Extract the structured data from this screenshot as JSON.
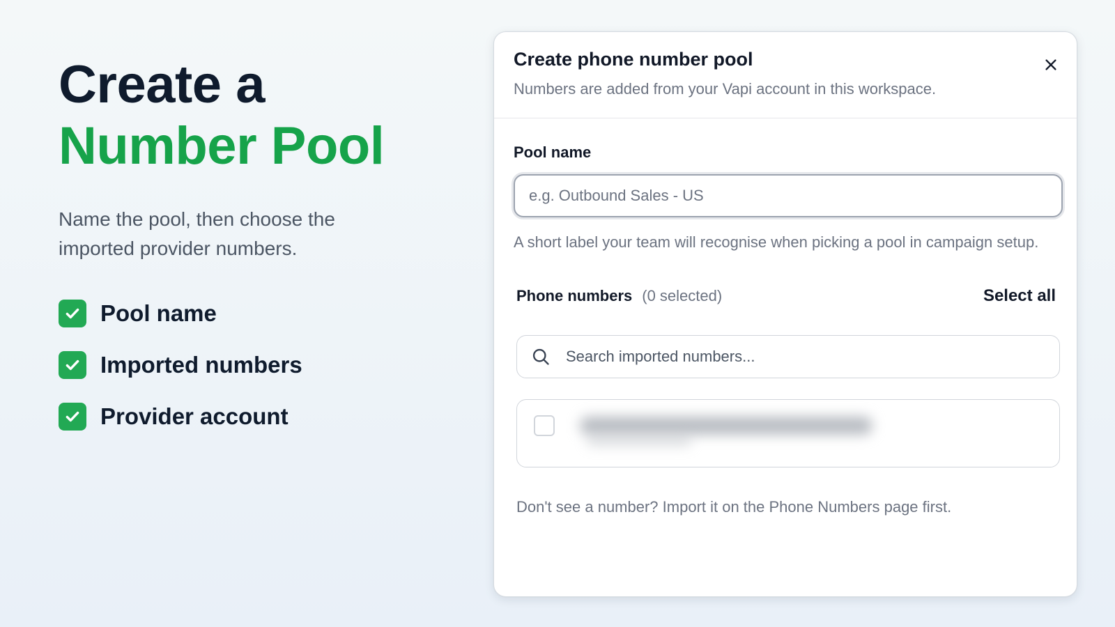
{
  "promo": {
    "title_line1": "Create a",
    "title_line2": "Number Pool",
    "subtitle": "Name the pool, then choose the imported provider numbers.",
    "checklist": [
      {
        "label": "Pool name",
        "icon": "check-icon"
      },
      {
        "label": "Imported numbers",
        "icon": "check-icon"
      },
      {
        "label": "Provider account",
        "icon": "check-icon"
      }
    ]
  },
  "modal": {
    "title": "Create phone number pool",
    "description": "Numbers are added from your Vapi account in this workspace.",
    "close_icon": "close-icon",
    "pool_name": {
      "label": "Pool name",
      "value": "",
      "placeholder": "e.g. Outbound Sales - US",
      "hint": "A short label your team will recognise when picking a pool in campaign setup."
    },
    "phone_numbers": {
      "label": "Phone numbers",
      "count_text": "(0 selected)",
      "select_all": "Select all",
      "search_placeholder": "Search imported numbers...",
      "search_icon": "search-icon",
      "items": [
        {
          "checked": false
        }
      ]
    },
    "footer_note": "Don't see a number? Import it on the Phone Numbers page first."
  },
  "colors": {
    "accent_green": "#16a34a",
    "check_green": "#22a954",
    "heading_dark": "#0f1b2d",
    "muted_text": "#6b7280"
  }
}
